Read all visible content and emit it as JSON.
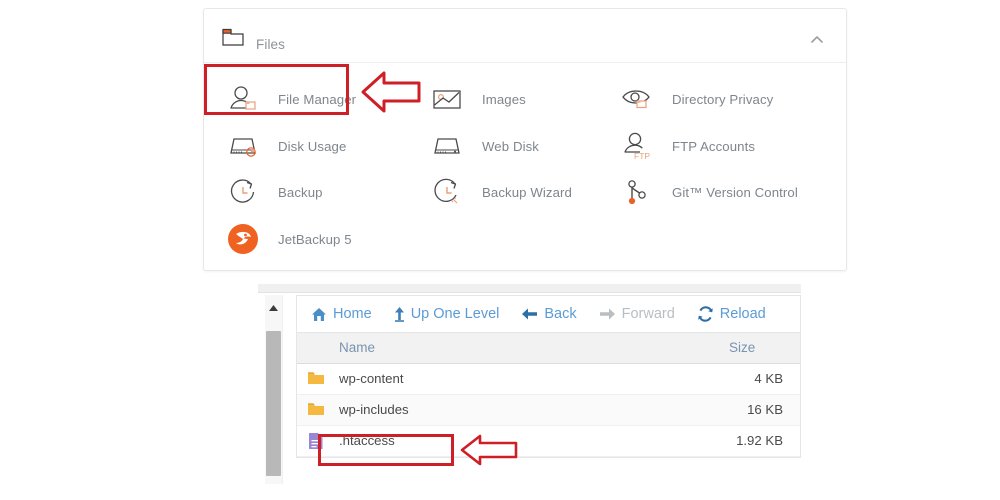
{
  "files_card": {
    "header": {
      "title": "Files",
      "folder_icon": "folder-icon",
      "collapse_icon": "chevron-up-icon"
    },
    "apps": [
      {
        "label": "File Manager",
        "icon": "file-manager-icon",
        "col": 1,
        "row": 1,
        "highlighted": true
      },
      {
        "label": "Images",
        "icon": "images-icon",
        "col": 2,
        "row": 1
      },
      {
        "label": "Directory Privacy",
        "icon": "directory-privacy-icon",
        "col": 3,
        "row": 1
      },
      {
        "label": "Disk Usage",
        "icon": "disk-usage-icon",
        "col": 1,
        "row": 2
      },
      {
        "label": "Web Disk",
        "icon": "web-disk-icon",
        "col": 2,
        "row": 2
      },
      {
        "label": "FTP Accounts",
        "icon": "ftp-accounts-icon",
        "col": 3,
        "row": 2
      },
      {
        "label": "Backup",
        "icon": "backup-icon",
        "col": 1,
        "row": 3
      },
      {
        "label": "Backup Wizard",
        "icon": "backup-wizard-icon",
        "col": 2,
        "row": 3
      },
      {
        "label": "Git™ Version Control",
        "icon": "git-icon",
        "col": 3,
        "row": 3
      },
      {
        "label": "JetBackup 5",
        "icon": "jetbackup-icon",
        "col": 1,
        "row": 4
      }
    ]
  },
  "file_manager": {
    "toolbar": [
      {
        "label": "Home",
        "icon": "home-icon",
        "disabled": false
      },
      {
        "label": "Up One Level",
        "icon": "up-arrow-icon",
        "disabled": false
      },
      {
        "label": "Back",
        "icon": "arrow-left-icon",
        "disabled": false
      },
      {
        "label": "Forward",
        "icon": "arrow-right-icon",
        "disabled": true
      },
      {
        "label": "Reload",
        "icon": "reload-icon",
        "disabled": false
      }
    ],
    "columns": {
      "name": "Name",
      "size": "Size"
    },
    "rows": [
      {
        "name": "wp-content",
        "size": "4 KB",
        "icon": "folder-icon",
        "highlighted": false
      },
      {
        "name": "wp-includes",
        "size": "16 KB",
        "icon": "folder-icon",
        "highlighted": false
      },
      {
        "name": ".htaccess",
        "size": "1.92 KB",
        "icon": "file-icon",
        "highlighted": true
      }
    ],
    "scrollbar": {
      "up_icon": "scroll-up-arrow-icon"
    }
  },
  "annotations": {
    "color": "#cf1f26",
    "arrow_file_manager": "left-pointing-callout-arrow",
    "arrow_htaccess": "left-pointing-callout-arrow"
  },
  "colors": {
    "accent_orange": "#e8622a",
    "link_blue": "#5b9bd5",
    "label_gray": "#7e868c",
    "folder_yellow": "#f5b942",
    "highlight_red": "#cf1f26"
  }
}
